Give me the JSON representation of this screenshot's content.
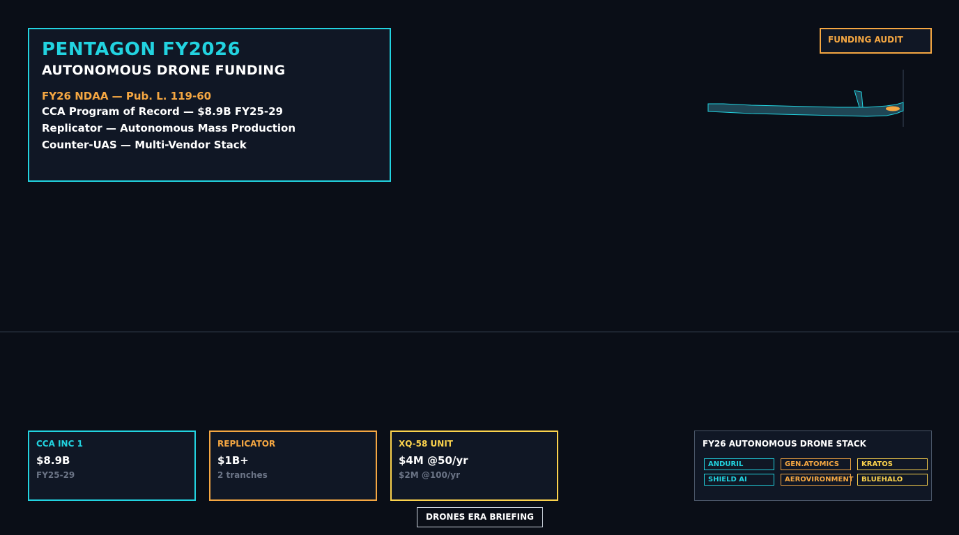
{
  "header": {
    "title": "PENTAGON FY2026",
    "subtitle": "AUTONOMOUS DRONE FUNDING",
    "law": "FY26 NDAA — Pub. L. 119-60",
    "lines": [
      "CCA Program of Record — $8.9B FY25-29",
      "Replicator — Autonomous Mass Production",
      "Counter-UAS — Multi-Vendor Stack"
    ]
  },
  "audit_button": {
    "label": "FUNDING AUDIT"
  },
  "cards": [
    {
      "label": "CCA INC 1",
      "value": "$8.9B",
      "sub": "FY25-29"
    },
    {
      "label": "REPLICATOR",
      "value": "$1B+",
      "sub": "2 tranches"
    },
    {
      "label": "XQ-58 UNIT",
      "value": "$4M @50/yr",
      "sub": "$2M @100/yr"
    }
  ],
  "stack": {
    "title": "FY26 AUTONOMOUS DRONE STACK",
    "vendors": [
      "ANDURIL",
      "GEN.ATOMICS",
      "KRATOS",
      "SHIELD AI",
      "AEROVIRONMENT",
      "BLUEHALO"
    ]
  },
  "briefing_button": {
    "label": "DRONES ERA BRIEFING"
  },
  "colors": {
    "background": "#0a0e17",
    "panel": "#101725",
    "cyan": "#22d3e0",
    "orange": "#f5a742",
    "yellow": "#fcd34d",
    "muted": "#6b7486"
  },
  "icons": {
    "drone": "drone-icon"
  }
}
